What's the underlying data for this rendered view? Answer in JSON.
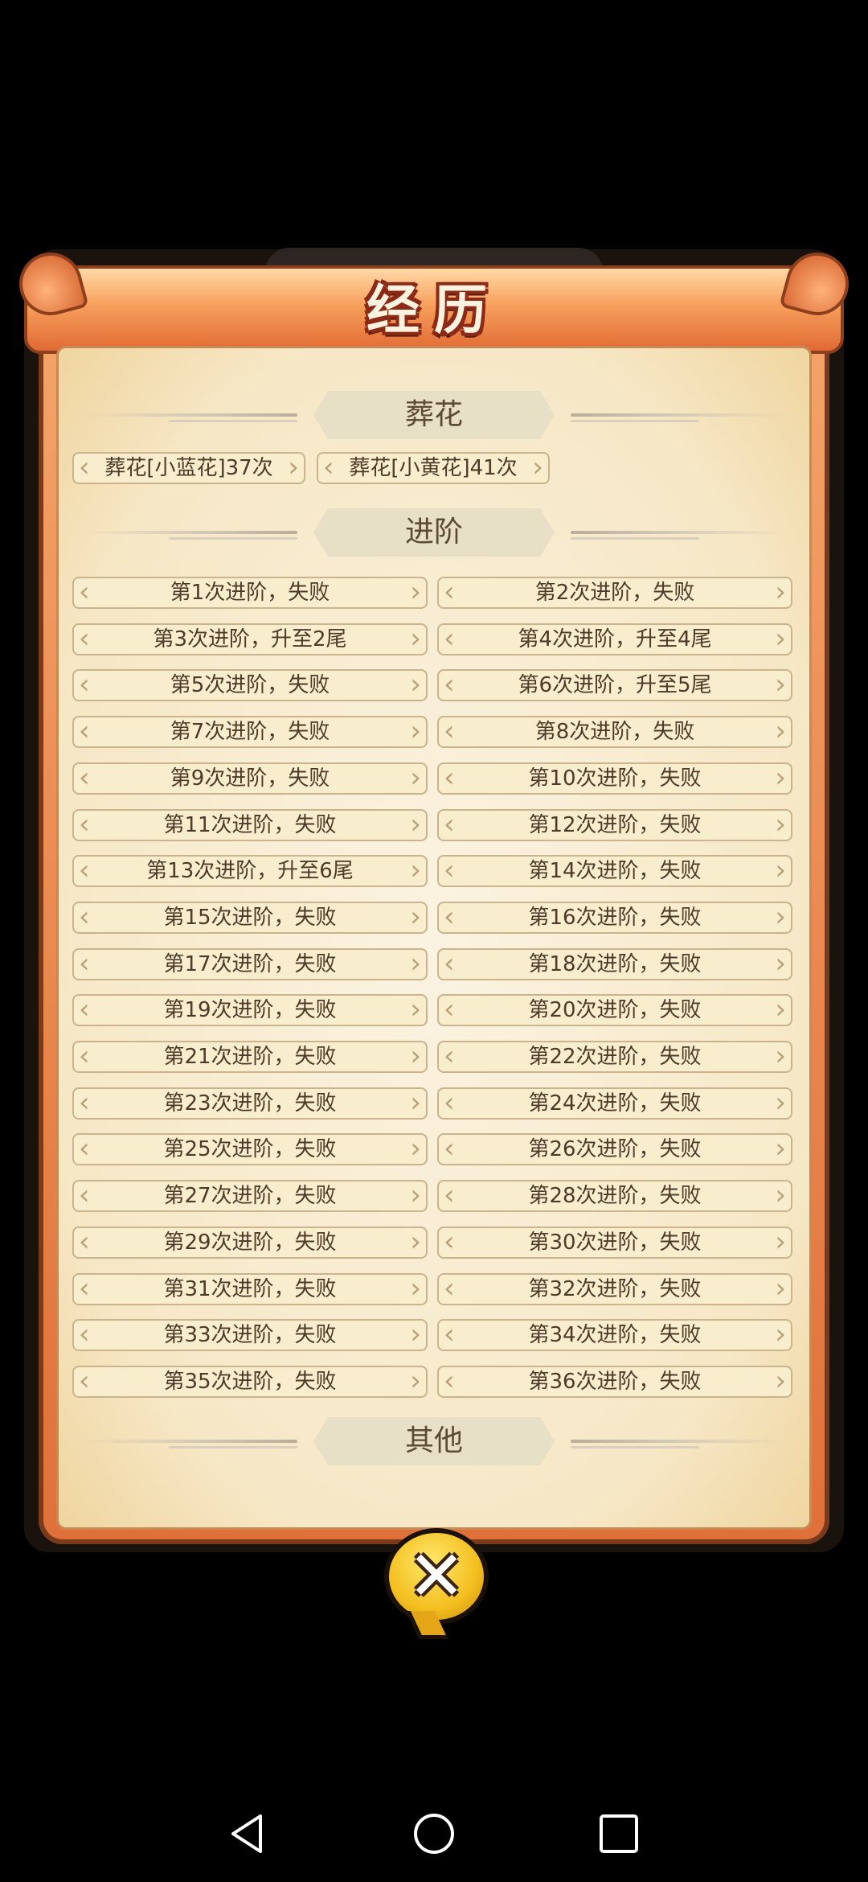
{
  "dialog": {
    "title": "经历"
  },
  "sections": {
    "flower": {
      "label": "葬花"
    },
    "advance": {
      "label": "进阶"
    },
    "other": {
      "label": "其他"
    }
  },
  "flower_entries": [
    "葬花[小蓝花]37次",
    "葬花[小黄花]41次"
  ],
  "advance_entries": [
    "第1次进阶，失败",
    "第2次进阶，失败",
    "第3次进阶，升至2尾",
    "第4次进阶，升至4尾",
    "第5次进阶，失败",
    "第6次进阶，升至5尾",
    "第7次进阶，失败",
    "第8次进阶，失败",
    "第9次进阶，失败",
    "第10次进阶，失败",
    "第11次进阶，失败",
    "第12次进阶，失败",
    "第13次进阶，升至6尾",
    "第14次进阶，失败",
    "第15次进阶，失败",
    "第16次进阶，失败",
    "第17次进阶，失败",
    "第18次进阶，失败",
    "第19次进阶，失败",
    "第20次进阶，失败",
    "第21次进阶，失败",
    "第22次进阶，失败",
    "第23次进阶，失败",
    "第24次进阶，失败",
    "第25次进阶，失败",
    "第26次进阶，失败",
    "第27次进阶，失败",
    "第28次进阶，失败",
    "第29次进阶，失败",
    "第30次进阶，失败",
    "第31次进阶，失败",
    "第32次进阶，失败",
    "第33次进阶，失败",
    "第34次进阶，失败",
    "第35次进阶，失败",
    "第36次进阶，失败"
  ],
  "close_button": {
    "icon": "close-x-icon",
    "glyph": "✕"
  },
  "navbar": {
    "icons": [
      "back-triangle-icon",
      "home-circle-icon",
      "recents-square-icon"
    ]
  },
  "colors": {
    "frame": "#e98a4c",
    "panel": "#f7ebcf",
    "pill": "#f8edcc",
    "close": "#f3be1f"
  }
}
